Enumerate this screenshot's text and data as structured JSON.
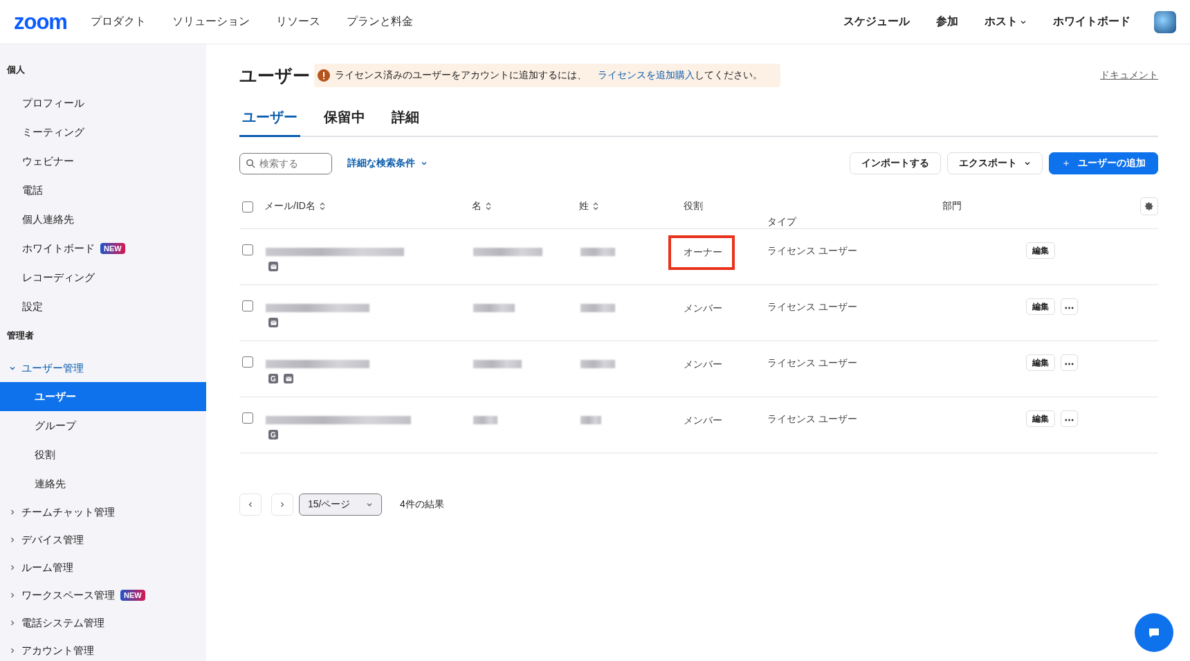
{
  "header": {
    "logo": "zoom",
    "nav": [
      "プロダクト",
      "ソリューション",
      "リソース",
      "プランと料金"
    ],
    "right_nav": [
      {
        "label": "スケジュール",
        "dropdown": false
      },
      {
        "label": "参加",
        "dropdown": false
      },
      {
        "label": "ホスト",
        "dropdown": true
      },
      {
        "label": "ホワイトボード",
        "dropdown": false
      }
    ]
  },
  "sidebar": {
    "sections": [
      {
        "title": "個人",
        "items": [
          {
            "label": "プロフィール",
            "selected": false
          },
          {
            "label": "ミーティング",
            "selected": false
          },
          {
            "label": "ウェビナー",
            "selected": false
          },
          {
            "label": "電話",
            "selected": false
          },
          {
            "label": "個人連絡先",
            "selected": false
          },
          {
            "label": "ホワイトボード",
            "badge": "NEW",
            "selected": false
          },
          {
            "label": "レコーディング",
            "selected": false
          },
          {
            "label": "設定",
            "selected": false
          }
        ]
      },
      {
        "title": "管理者",
        "items": [
          {
            "label": "ユーザー管理",
            "expanded": true,
            "children": [
              {
                "label": "ユーザー",
                "selected": true
              },
              {
                "label": "グループ",
                "selected": false
              },
              {
                "label": "役割",
                "selected": false
              },
              {
                "label": "連絡先",
                "selected": false
              }
            ]
          },
          {
            "label": "チームチャット管理",
            "expanded": false
          },
          {
            "label": "デバイス管理",
            "expanded": false
          },
          {
            "label": "ルーム管理",
            "expanded": false
          },
          {
            "label": "ワークスペース管理",
            "badge": "NEW",
            "expanded": false
          },
          {
            "label": "電話システム管理",
            "expanded": false
          },
          {
            "label": "アカウント管理",
            "expanded": false
          }
        ]
      }
    ]
  },
  "page": {
    "title": "ユーザー",
    "notice": {
      "text": "ライセンス済みのユーザーをアカウントに追加するには、",
      "link": "ライセンスを追加購入",
      "after": "してください。"
    },
    "doc_link": "ドキュメント",
    "tabs": [
      {
        "label": "ユーザー",
        "selected": true
      },
      {
        "label": "保留中",
        "selected": false
      },
      {
        "label": "詳細",
        "selected": false
      }
    ],
    "search": {
      "placeholder": "検索する"
    },
    "filter": "詳細な検索条件",
    "buttons": [
      {
        "label": "インポートする",
        "kind": "plain"
      },
      {
        "label": "エクスポート",
        "kind": "dropdown"
      },
      {
        "label": "ユーザーの追加",
        "kind": "primary",
        "icon": "＋"
      }
    ]
  },
  "table": {
    "select_all_checked": false,
    "columns": [
      {
        "label": "メール/ID名",
        "sortable": true
      },
      {
        "label": "名",
        "sortable": true
      },
      {
        "label": "姓",
        "sortable": true
      },
      {
        "label": "役割",
        "sortable": false
      },
      {
        "label": "タイプ",
        "sortable": false
      },
      {
        "label": "部門",
        "sortable": false
      }
    ],
    "rows": [
      {
        "checked": false,
        "logins": [
          {
            "kind": "mail"
          }
        ],
        "role": "オーナー",
        "highlighted": true,
        "type": "ライセンス ユーザー",
        "edit": "編集",
        "more": false
      },
      {
        "checked": false,
        "logins": [
          {
            "kind": "mail"
          }
        ],
        "role": "メンバー",
        "highlighted": false,
        "type": "ライセンス ユーザー",
        "edit": "編集",
        "more": true
      },
      {
        "checked": false,
        "logins": [
          {
            "kind": "google",
            "label": "G"
          },
          {
            "kind": "mail"
          }
        ],
        "role": "メンバー",
        "highlighted": false,
        "type": "ライセンス ユーザー",
        "edit": "編集",
        "more": true
      },
      {
        "checked": false,
        "logins": [
          {
            "kind": "google",
            "label": "G"
          }
        ],
        "role": "メンバー",
        "highlighted": false,
        "type": "ライセンス ユーザー",
        "edit": "編集",
        "more": true
      }
    ]
  },
  "pagination": {
    "per_page": "15/ページ",
    "results": "4件の結果"
  }
}
